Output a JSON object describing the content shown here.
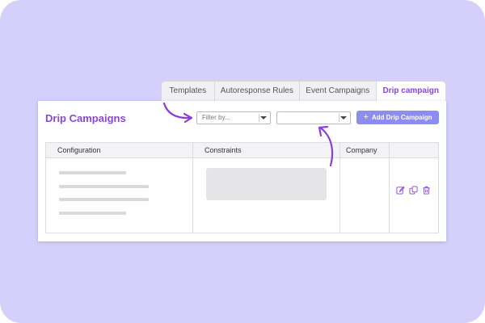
{
  "tabs": [
    {
      "label": "Templates",
      "active": false
    },
    {
      "label": "Autoresponse Rules",
      "active": false
    },
    {
      "label": "Event Campaigns",
      "active": false
    },
    {
      "label": "Drip campaign",
      "active": true
    }
  ],
  "header": {
    "title": "Drip Campaigns",
    "filter_placeholder": "Filter by...",
    "second_filter_value": "",
    "add_button_label": "Add Drip Campaign"
  },
  "table": {
    "columns": [
      "Configuration",
      "Constraints",
      "Company",
      ""
    ]
  },
  "icons": {
    "edit": "edit-icon",
    "copy": "copy-icon",
    "delete": "trash-icon",
    "plus": "plus-icon",
    "caret": "chevron-down-icon"
  },
  "colors": {
    "backdrop": "#d4d0fb",
    "accent_purple": "#8a47d6",
    "button": "#8d8cf0",
    "arrow": "#8a3fd9"
  }
}
